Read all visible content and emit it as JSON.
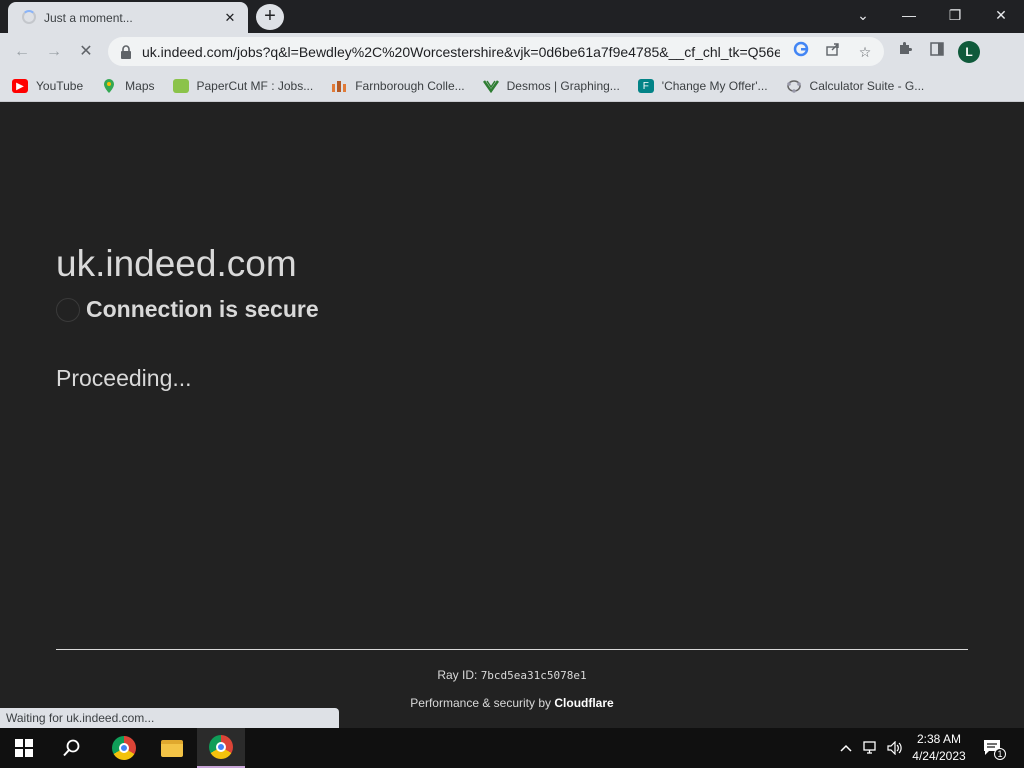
{
  "browser": {
    "tab_title": "Just a moment...",
    "tab_close": "✕",
    "new_tab": "+",
    "url": "uk.indeed.com/jobs?q&l=Bewdley%2C%20Worcestershire&vjk=0d6be61a7f9e4785&__cf_chl_tk=Q56e...",
    "profile_initial": "L",
    "window_controls": {
      "tabsearch": "⌄",
      "minimize": "—",
      "restore": "❐",
      "close": "✕"
    },
    "nav": {
      "back": "←",
      "forward": "→",
      "stop": "✕"
    }
  },
  "bookmarks": [
    {
      "label": "YouTube",
      "icon": "youtube-icon",
      "color": "#ff0000"
    },
    {
      "label": "Maps",
      "icon": "maps-icon",
      "color": "#34a853"
    },
    {
      "label": "PaperCut MF : Jobs...",
      "icon": "papercut-icon",
      "color": "#8bc34a"
    },
    {
      "label": "Farnborough Colle...",
      "icon": "college-icon",
      "color": "#e07b39"
    },
    {
      "label": "Desmos | Graphing...",
      "icon": "desmos-icon",
      "color": "#2e7d32"
    },
    {
      "label": "'Change My Offer'...",
      "icon": "forms-icon",
      "color": "#038387"
    },
    {
      "label": "Calculator Suite - G...",
      "icon": "geogebra-icon",
      "color": "#666666"
    }
  ],
  "page": {
    "host": "uk.indeed.com",
    "secure_text": "Connection is secure",
    "proceeding_text": "Proceeding...",
    "ray_label": "Ray ID:",
    "ray_id": "7bcd5ea31c5078e1",
    "perf_label": "Performance & security by",
    "perf_brand": "Cloudflare"
  },
  "status_bar": {
    "text": "Waiting for uk.indeed.com..."
  },
  "taskbar": {
    "time": "2:38 AM",
    "date": "4/24/2023",
    "notification_count": "1"
  }
}
